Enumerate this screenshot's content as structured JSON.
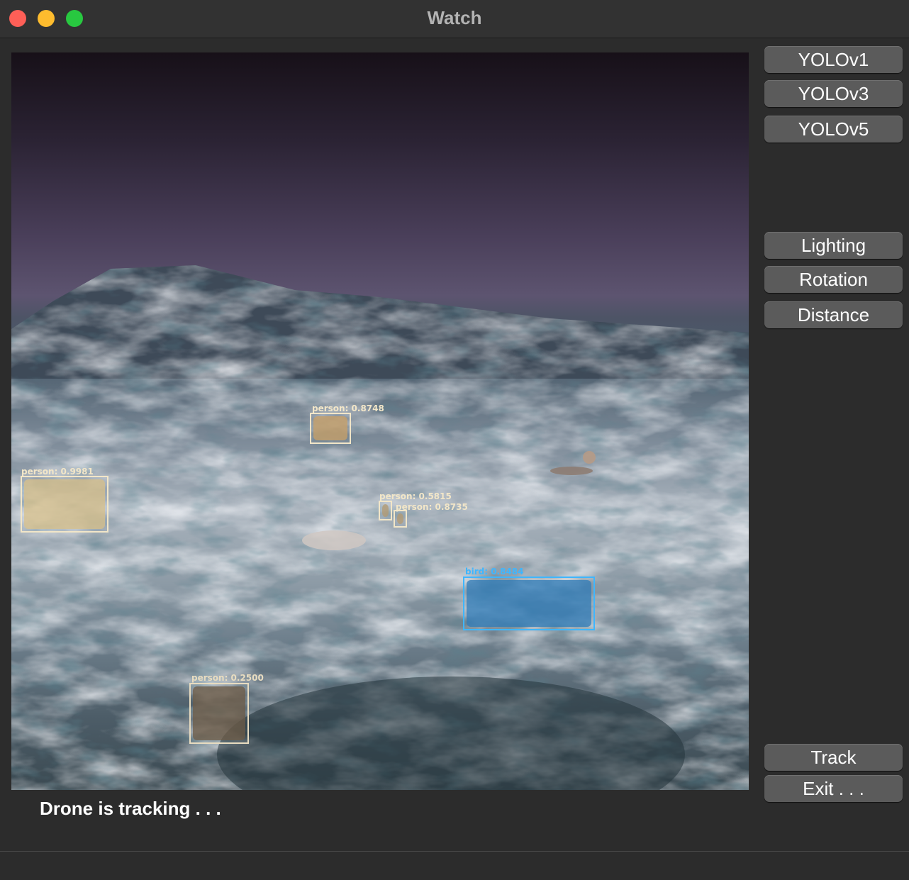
{
  "window": {
    "title": "Watch"
  },
  "model_buttons": [
    {
      "label": "YOLOv1"
    },
    {
      "label": "YOLOv3"
    },
    {
      "label": "YOLOv5"
    }
  ],
  "condition_buttons": [
    {
      "label": "Lighting"
    },
    {
      "label": "Rotation"
    },
    {
      "label": "Distance"
    }
  ],
  "action_buttons": [
    {
      "label": "Track"
    },
    {
      "label": "Exit . . ."
    }
  ],
  "status_text": "Drone is tracking . . .",
  "detections": [
    {
      "label": "person: 0.8748",
      "color": "#f2e6c8"
    },
    {
      "label": "person: 0.9981",
      "color": "#f2e6c8"
    },
    {
      "label": "person: 0.5815",
      "color": "#f2e6c8"
    },
    {
      "label": "person: 0.8735",
      "color": "#f2e6c8"
    },
    {
      "label": "bird: 0.8484",
      "color": "#3fb6ff"
    },
    {
      "label": "person: 0.2500",
      "color": "#e8dcc0"
    }
  ]
}
